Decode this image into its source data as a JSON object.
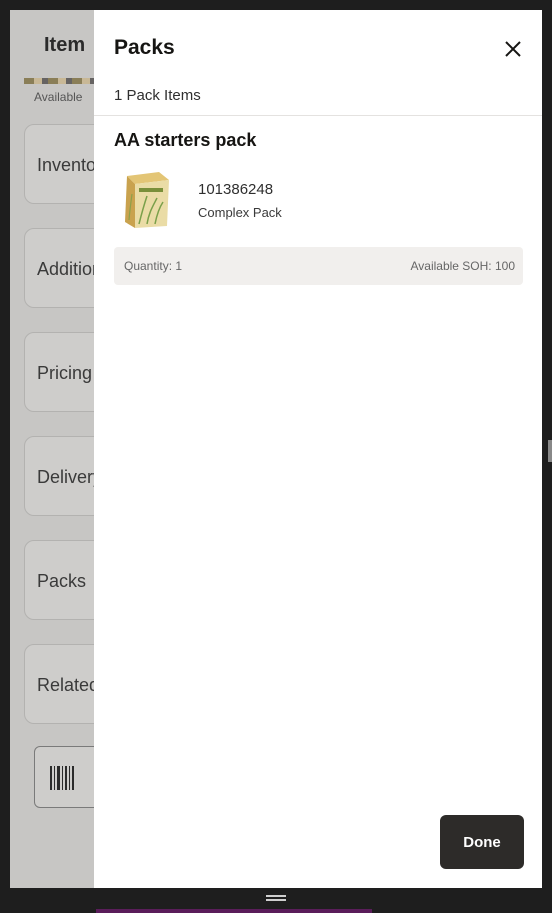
{
  "background": {
    "title": "Item",
    "available_label": "Available",
    "cards": [
      "Inventory",
      "Additional",
      "Pricing",
      "Delivery",
      "Packs",
      "Related"
    ],
    "scan_icon": "barcode-icon"
  },
  "drawer": {
    "title": "Packs",
    "close_icon": "close-icon",
    "item_count": "1 Pack Items",
    "pack": {
      "name": "AA starters pack",
      "item_number": "101386248",
      "item_type": "Complex Pack",
      "quantity": "Quantity: 1",
      "available_soh": "Available SOH: 100"
    },
    "done_label": "Done"
  },
  "colors": {
    "drawer_bg": "#ffffff",
    "overlay_bg": "#c7c6c4",
    "done_button": "#2d2b29",
    "qty_bar_bg": "#f1efed"
  }
}
